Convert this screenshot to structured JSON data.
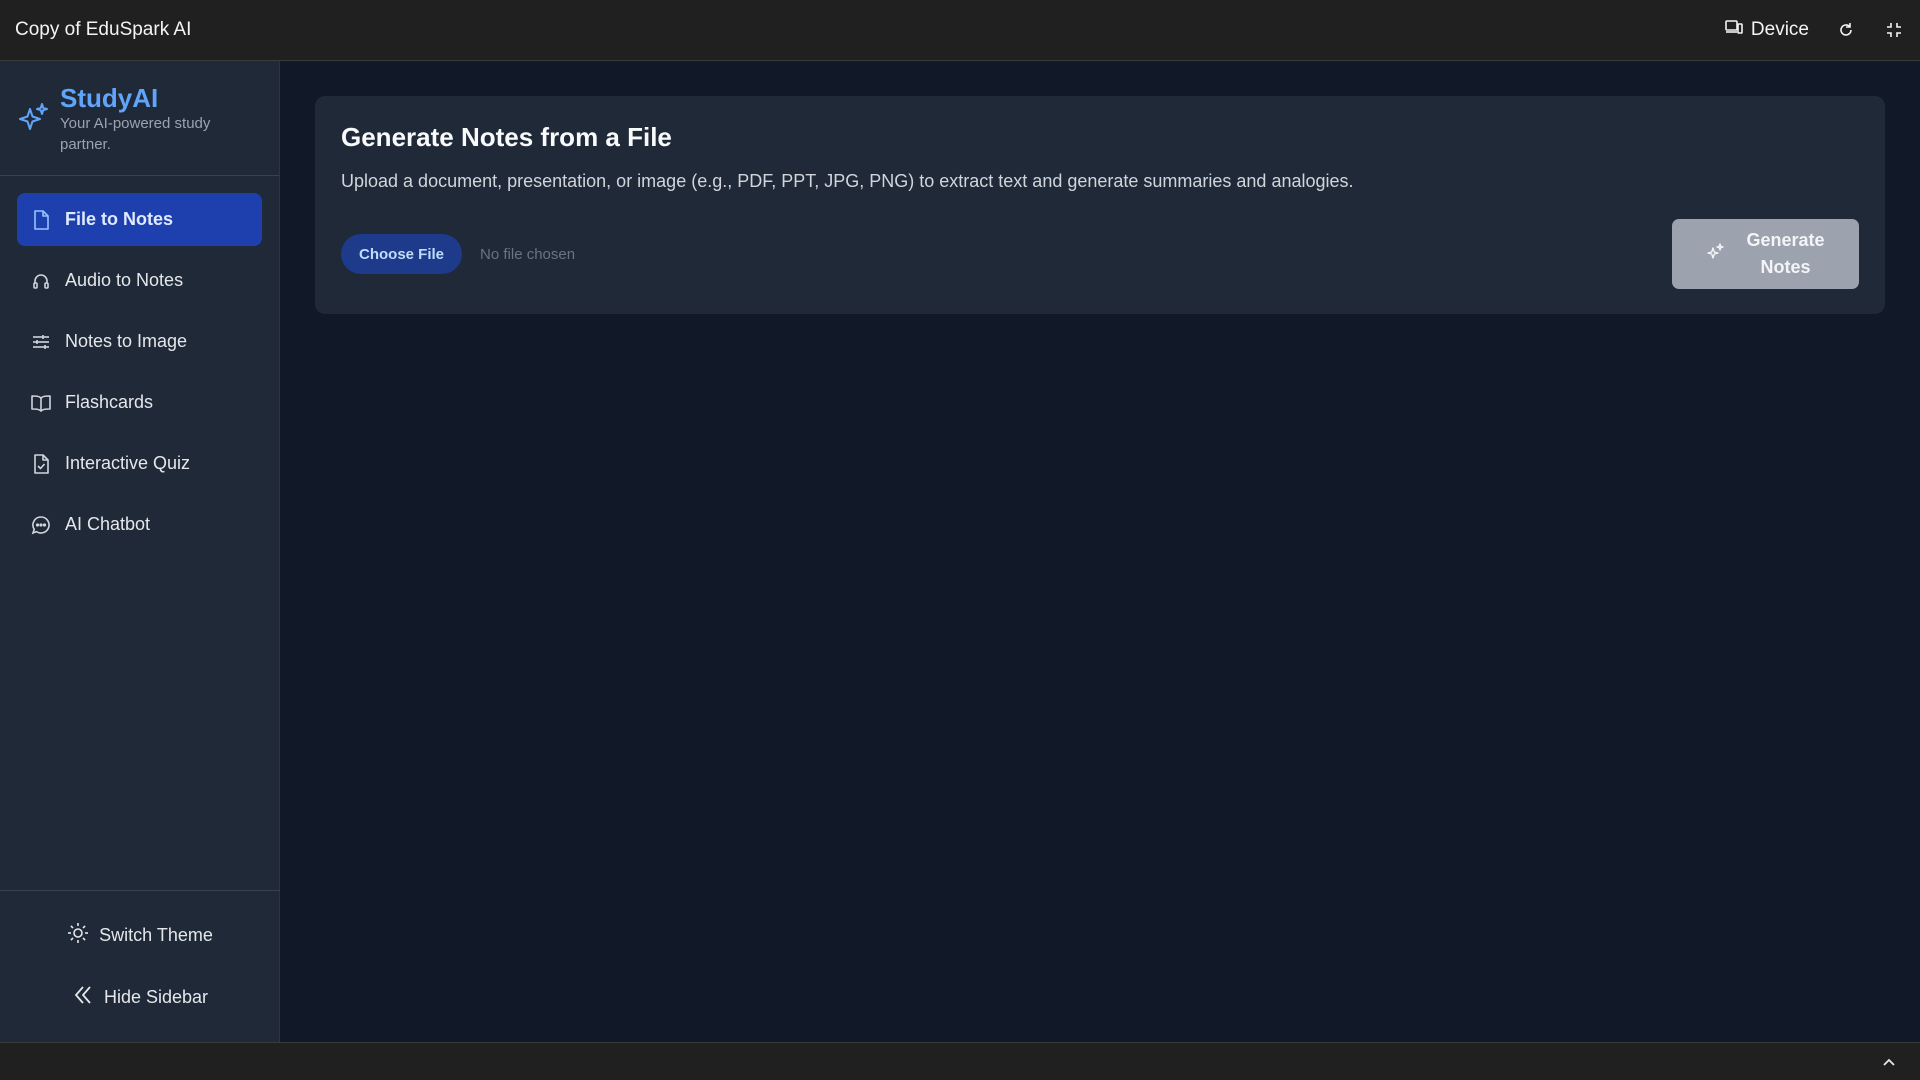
{
  "window": {
    "title": "Copy of EduSpark AI",
    "device_label": "Device"
  },
  "brand": {
    "name": "StudyAI",
    "tagline": "Your AI-powered study partner."
  },
  "sidebar": {
    "items": [
      {
        "label": "File to Notes",
        "icon": "file-icon",
        "active": true
      },
      {
        "label": "Audio to Notes",
        "icon": "headset-icon",
        "active": false
      },
      {
        "label": "Notes to Image",
        "icon": "sliders-icon",
        "active": false
      },
      {
        "label": "Flashcards",
        "icon": "book-open-icon",
        "active": false
      },
      {
        "label": "Interactive Quiz",
        "icon": "file-check-icon",
        "active": false
      },
      {
        "label": "AI Chatbot",
        "icon": "chat-bubble-icon",
        "active": false
      }
    ],
    "switch_theme": "Switch Theme",
    "hide_sidebar": "Hide Sidebar"
  },
  "main": {
    "title": "Generate Notes from a File",
    "description": "Upload a document, presentation, or image (e.g., PDF, PPT, JPG, PNG) to extract text and generate summaries and analogies.",
    "choose_file": "Choose File",
    "no_file": "No file chosen",
    "generate": "Generate Notes"
  },
  "colors": {
    "accent": "#60a5fa",
    "active_nav": "#1e40af",
    "sidebar_bg": "#1f2937",
    "main_bg": "#111827",
    "button_disabled": "#9ca3af"
  }
}
